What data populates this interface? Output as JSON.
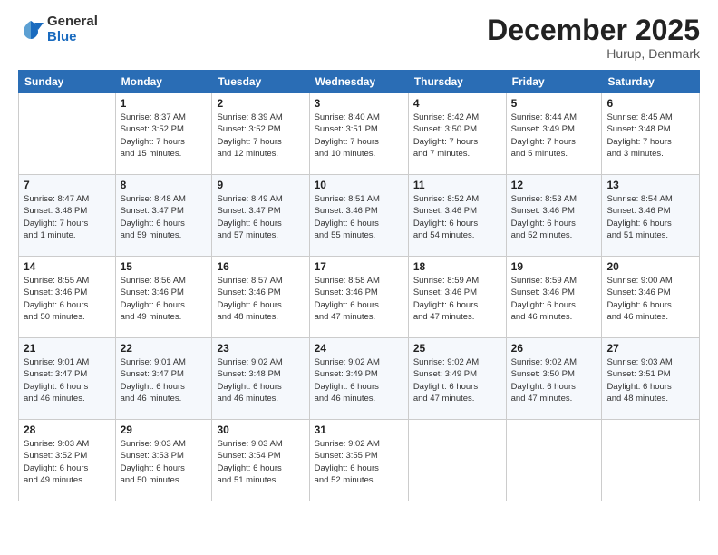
{
  "header": {
    "logo_general": "General",
    "logo_blue": "Blue",
    "month_title": "December 2025",
    "location": "Hurup, Denmark"
  },
  "days_of_week": [
    "Sunday",
    "Monday",
    "Tuesday",
    "Wednesday",
    "Thursday",
    "Friday",
    "Saturday"
  ],
  "weeks": [
    [
      {
        "day": "",
        "info": ""
      },
      {
        "day": "1",
        "info": "Sunrise: 8:37 AM\nSunset: 3:52 PM\nDaylight: 7 hours\nand 15 minutes."
      },
      {
        "day": "2",
        "info": "Sunrise: 8:39 AM\nSunset: 3:52 PM\nDaylight: 7 hours\nand 12 minutes."
      },
      {
        "day": "3",
        "info": "Sunrise: 8:40 AM\nSunset: 3:51 PM\nDaylight: 7 hours\nand 10 minutes."
      },
      {
        "day": "4",
        "info": "Sunrise: 8:42 AM\nSunset: 3:50 PM\nDaylight: 7 hours\nand 7 minutes."
      },
      {
        "day": "5",
        "info": "Sunrise: 8:44 AM\nSunset: 3:49 PM\nDaylight: 7 hours\nand 5 minutes."
      },
      {
        "day": "6",
        "info": "Sunrise: 8:45 AM\nSunset: 3:48 PM\nDaylight: 7 hours\nand 3 minutes."
      }
    ],
    [
      {
        "day": "7",
        "info": "Sunrise: 8:47 AM\nSunset: 3:48 PM\nDaylight: 7 hours\nand 1 minute."
      },
      {
        "day": "8",
        "info": "Sunrise: 8:48 AM\nSunset: 3:47 PM\nDaylight: 6 hours\nand 59 minutes."
      },
      {
        "day": "9",
        "info": "Sunrise: 8:49 AM\nSunset: 3:47 PM\nDaylight: 6 hours\nand 57 minutes."
      },
      {
        "day": "10",
        "info": "Sunrise: 8:51 AM\nSunset: 3:46 PM\nDaylight: 6 hours\nand 55 minutes."
      },
      {
        "day": "11",
        "info": "Sunrise: 8:52 AM\nSunset: 3:46 PM\nDaylight: 6 hours\nand 54 minutes."
      },
      {
        "day": "12",
        "info": "Sunrise: 8:53 AM\nSunset: 3:46 PM\nDaylight: 6 hours\nand 52 minutes."
      },
      {
        "day": "13",
        "info": "Sunrise: 8:54 AM\nSunset: 3:46 PM\nDaylight: 6 hours\nand 51 minutes."
      }
    ],
    [
      {
        "day": "14",
        "info": "Sunrise: 8:55 AM\nSunset: 3:46 PM\nDaylight: 6 hours\nand 50 minutes."
      },
      {
        "day": "15",
        "info": "Sunrise: 8:56 AM\nSunset: 3:46 PM\nDaylight: 6 hours\nand 49 minutes."
      },
      {
        "day": "16",
        "info": "Sunrise: 8:57 AM\nSunset: 3:46 PM\nDaylight: 6 hours\nand 48 minutes."
      },
      {
        "day": "17",
        "info": "Sunrise: 8:58 AM\nSunset: 3:46 PM\nDaylight: 6 hours\nand 47 minutes."
      },
      {
        "day": "18",
        "info": "Sunrise: 8:59 AM\nSunset: 3:46 PM\nDaylight: 6 hours\nand 47 minutes."
      },
      {
        "day": "19",
        "info": "Sunrise: 8:59 AM\nSunset: 3:46 PM\nDaylight: 6 hours\nand 46 minutes."
      },
      {
        "day": "20",
        "info": "Sunrise: 9:00 AM\nSunset: 3:46 PM\nDaylight: 6 hours\nand 46 minutes."
      }
    ],
    [
      {
        "day": "21",
        "info": "Sunrise: 9:01 AM\nSunset: 3:47 PM\nDaylight: 6 hours\nand 46 minutes."
      },
      {
        "day": "22",
        "info": "Sunrise: 9:01 AM\nSunset: 3:47 PM\nDaylight: 6 hours\nand 46 minutes."
      },
      {
        "day": "23",
        "info": "Sunrise: 9:02 AM\nSunset: 3:48 PM\nDaylight: 6 hours\nand 46 minutes."
      },
      {
        "day": "24",
        "info": "Sunrise: 9:02 AM\nSunset: 3:49 PM\nDaylight: 6 hours\nand 46 minutes."
      },
      {
        "day": "25",
        "info": "Sunrise: 9:02 AM\nSunset: 3:49 PM\nDaylight: 6 hours\nand 47 minutes."
      },
      {
        "day": "26",
        "info": "Sunrise: 9:02 AM\nSunset: 3:50 PM\nDaylight: 6 hours\nand 47 minutes."
      },
      {
        "day": "27",
        "info": "Sunrise: 9:03 AM\nSunset: 3:51 PM\nDaylight: 6 hours\nand 48 minutes."
      }
    ],
    [
      {
        "day": "28",
        "info": "Sunrise: 9:03 AM\nSunset: 3:52 PM\nDaylight: 6 hours\nand 49 minutes."
      },
      {
        "day": "29",
        "info": "Sunrise: 9:03 AM\nSunset: 3:53 PM\nDaylight: 6 hours\nand 50 minutes."
      },
      {
        "day": "30",
        "info": "Sunrise: 9:03 AM\nSunset: 3:54 PM\nDaylight: 6 hours\nand 51 minutes."
      },
      {
        "day": "31",
        "info": "Sunrise: 9:02 AM\nSunset: 3:55 PM\nDaylight: 6 hours\nand 52 minutes."
      },
      {
        "day": "",
        "info": ""
      },
      {
        "day": "",
        "info": ""
      },
      {
        "day": "",
        "info": ""
      }
    ]
  ]
}
